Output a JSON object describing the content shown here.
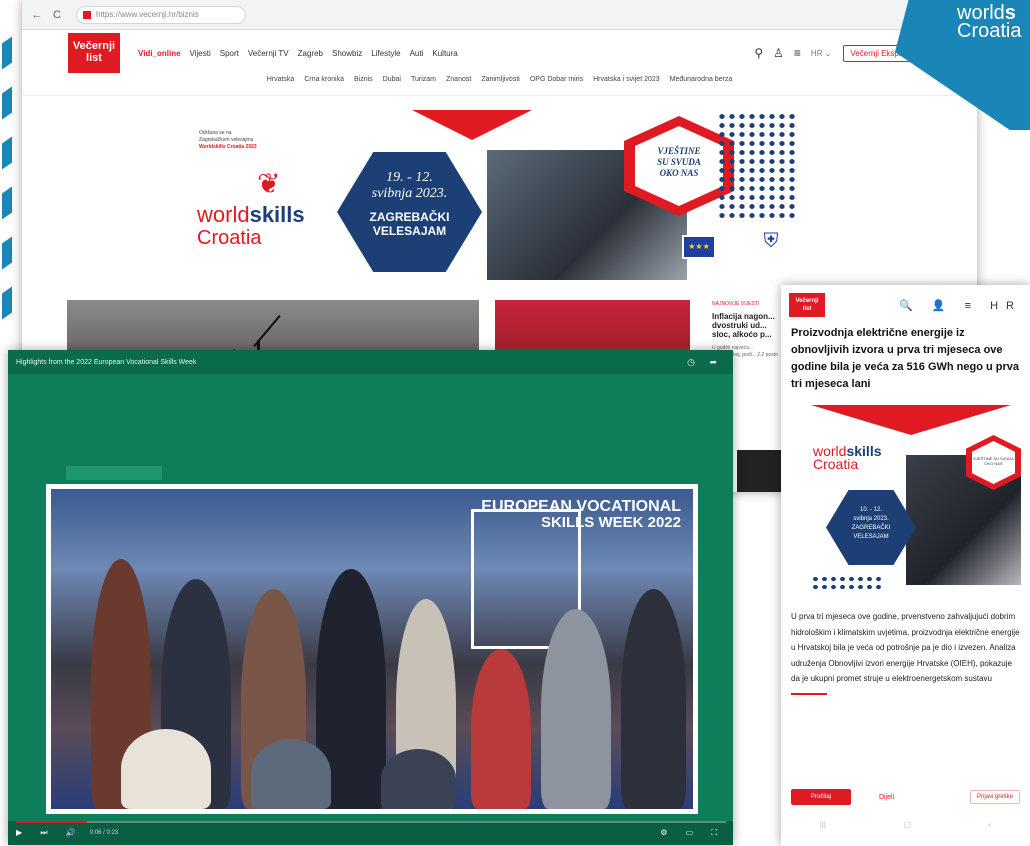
{
  "browser": {
    "url": "https://www.vecernji.hr/biznis",
    "tab_icons": {
      "back": "←",
      "reload": "C"
    },
    "window_icon": "▢"
  },
  "site": {
    "logo_line1": "Večernji",
    "logo_line2": "list",
    "nav": [
      "Vidi_online",
      "Vijesti",
      "Sport",
      "Večernji TV",
      "Zagreb",
      "Showbiz",
      "Lifestyle",
      "Auti",
      "Kultura"
    ],
    "lang": "HR ⌄",
    "subscribe": "Večernji Ekspres",
    "sub_nav": [
      "Hrvatska",
      "Crna kronika",
      "Biznis",
      "Dubai",
      "Turizam",
      "Znanost",
      "Zanimljivosti",
      "OPG Dobar miris",
      "Hrvatska i svijet 2023",
      "Međunarodna berza"
    ]
  },
  "banner": {
    "small_text_1": "Održava se na",
    "small_text_2": "Zagrebačkom velesajmu",
    "small_text_3": "Worldskills Croatia 2023",
    "ws_world": "world",
    "ws_skills": "skills",
    "ws_country": "Croatia",
    "date_line1": "19. - 12.",
    "date_line2": "svibnja 2023.",
    "venue_line1": "ZAGREBAČKI",
    "venue_line2": "VELESAJAM",
    "vjestine_1": "VJEŠTINE",
    "vjestine_2": "SU SVUDA",
    "vjestine_3": "OKO NAS",
    "eu_stars": "★★★",
    "crest": "⛨"
  },
  "articles": {
    "kicker": "NAJNOVIJE VIJESTI",
    "headline": "Inflacija nagon... dvostruki ud... sloc, alkoćo p...",
    "teaser": "U godini najveća... optimističnoj, podi... 2,2 posto kao i k..."
  },
  "ws_badge": {
    "line1_a": "world",
    "line1_b": "s",
    "line2": "Croatia"
  },
  "video": {
    "title": "Highlights from the 2022 European Vocational Skills Week",
    "overlay_line1": "EUROPEAN VOCATIONAL",
    "overlay_line2": "SKILLS WEEK 2022",
    "controls_left": "▶ ⏭ 🔊",
    "time": "0:06 / 0:23",
    "controls_right": "⚙ ▭ ⛶"
  },
  "mobile": {
    "logo_1": "Večernji",
    "logo_2": "list",
    "tools": "🔍 👤 ≡ HR",
    "title": "Proizvodnja električne energije iz obnovljivih izvora u prva tri mjeseca ove godine bila je veća za 516 GWh nego u prva tri mjeseca lani",
    "ws": "world",
    "ws_b": "skills",
    "ws_c": "Croatia",
    "hex_text_1": "10. - 12.",
    "hex_text_2": "svibnja 2023.",
    "hex_text_3": "ZAGREBAČKI",
    "hex_text_4": "VELESAJAM",
    "redhex_text": "VJEŠTINE SU SVUDA OKO NAS",
    "body": "U prva tri mjeseca ove godine, prvenstveno zahvaljujući dobrim hidrološkim i klimatskim uvjetima, proizvodnja električne energije u Hrvatskoj bila je veća od potrošnje pa je dio i izvezen. Analiza udruženja Obnovljivi izvori energije Hrvatske (OIEH), pokazuje da je ukupni promet struje u elektroenergetskom sustavu",
    "btn_left": "Pročitaj",
    "btn_mid": "Dijeli",
    "btn_right": "Prijavi greške",
    "bottom_left": "|||",
    "bottom_mid": "▢",
    "bottom_right": "‹"
  },
  "colors": {
    "brand_red": "#e01a22",
    "ws_blue": "#1c3f76",
    "teal": "#1a86b8",
    "video_green": "#0d7d5a"
  }
}
